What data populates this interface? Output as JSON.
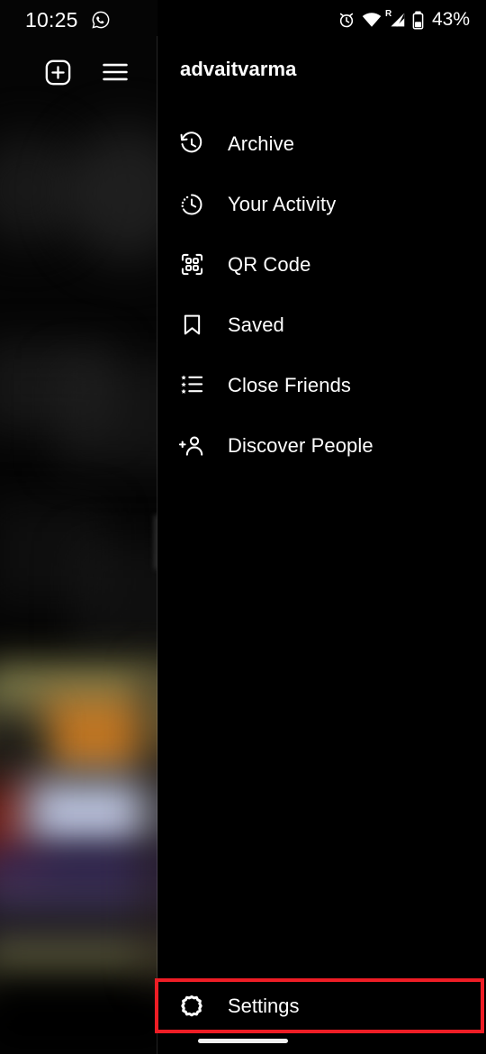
{
  "status_bar": {
    "time": "10:25",
    "whatsapp_icon": "whatsapp-icon",
    "alarm_icon": "alarm-clock-icon",
    "wifi_icon": "wifi-icon",
    "signal_icon": "cellular-signal-roaming-icon",
    "roaming_label": "R",
    "battery_icon": "battery-icon",
    "battery_percent": "43%"
  },
  "feed_actions": [
    {
      "name": "new-post-button",
      "icon": "plus-square-icon"
    },
    {
      "name": "menu-hamburger-button",
      "icon": "hamburger-menu-icon"
    }
  ],
  "drawer": {
    "username": "advaitvarma",
    "menu_items": [
      {
        "label": "Archive",
        "icon": "archive-clock-icon"
      },
      {
        "label": "Your Activity",
        "icon": "activity-clock-icon"
      },
      {
        "label": "QR Code",
        "icon": "qr-code-icon"
      },
      {
        "label": "Saved",
        "icon": "bookmark-icon"
      },
      {
        "label": "Close Friends",
        "icon": "close-friends-star-list-icon"
      },
      {
        "label": "Discover People",
        "icon": "person-add-icon"
      }
    ],
    "settings": {
      "label": "Settings",
      "icon": "settings-gear-icon",
      "highlighted": true,
      "highlight_color": "#EE1D25"
    }
  },
  "colors": {
    "background": "#000000",
    "text": "#FFFFFF",
    "highlight": "#EE1D25",
    "home_indicator": "#F2F2F2"
  }
}
